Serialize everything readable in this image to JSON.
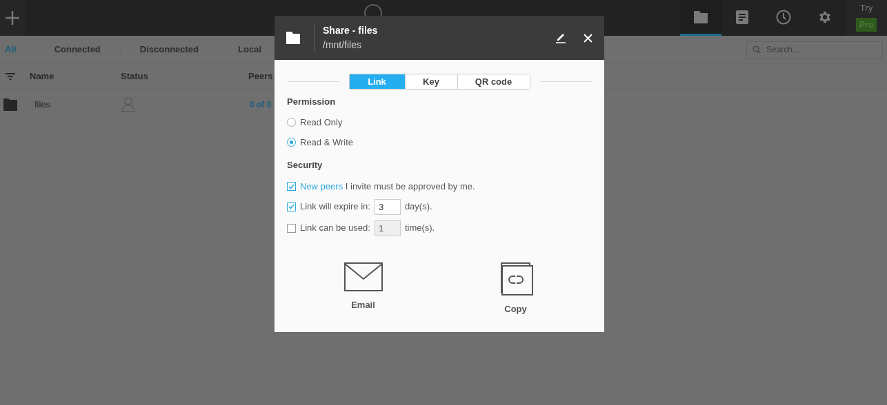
{
  "app": {
    "nav": [
      {
        "kind": "folder",
        "selected": true
      },
      {
        "kind": "doc",
        "selected": false
      },
      {
        "kind": "clock",
        "selected": false
      },
      {
        "kind": "gear",
        "selected": false
      }
    ],
    "upgrade": {
      "label": "Try",
      "badge": "Pro"
    }
  },
  "filters": [
    {
      "label": "All",
      "selected": true
    },
    {
      "label": "Connected",
      "selected": false
    },
    {
      "label": "Disconnected",
      "selected": false
    },
    {
      "label": "Local",
      "selected": false
    }
  ],
  "search": {
    "placeholder": "Search..."
  },
  "table": {
    "columns": [
      "Name",
      "Status",
      "Peers"
    ],
    "rows": [
      {
        "name": "files",
        "peers": "0 of 0"
      }
    ]
  },
  "dialog": {
    "title": "Share - files",
    "subtitle": "/mnt/files",
    "tabs": [
      {
        "label": "Link",
        "selected": true
      },
      {
        "label": "Key",
        "selected": false
      },
      {
        "label": "QR code",
        "selected": false
      }
    ],
    "permission": {
      "heading": "Permission",
      "options": [
        {
          "label": "Read Only",
          "selected": false
        },
        {
          "label": "Read & Write",
          "selected": true
        }
      ]
    },
    "security": {
      "heading": "Security",
      "items": [
        {
          "kind": "text",
          "checked": true,
          "link": "New peers",
          "text": "I invite must be approved by me."
        },
        {
          "kind": "input",
          "checked": true,
          "label": "Link will expire in:",
          "value": "3",
          "unit": "day(s)."
        },
        {
          "kind": "input",
          "checked": false,
          "label": "Link can be used:",
          "value": "1",
          "unit": "time(s)."
        }
      ]
    },
    "actions": [
      {
        "kind": "email",
        "label": "Email"
      },
      {
        "kind": "copy",
        "label": "Copy"
      }
    ]
  }
}
